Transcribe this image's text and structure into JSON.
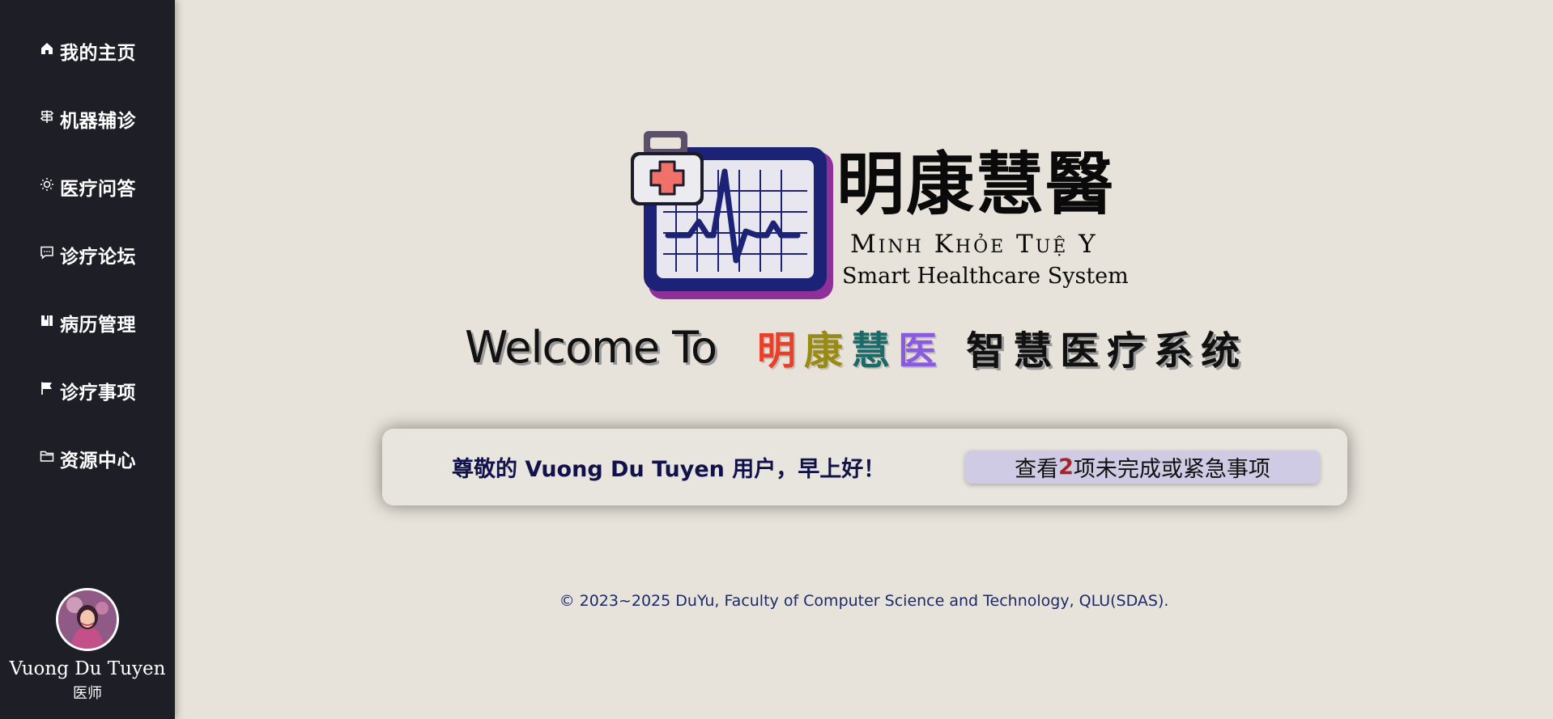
{
  "sidebar": {
    "items": [
      {
        "label": "我的主页",
        "icon": "home-icon"
      },
      {
        "label": "机器辅诊",
        "icon": "signpost-icon"
      },
      {
        "label": "医疗问答",
        "icon": "sun-icon"
      },
      {
        "label": "诊疗论坛",
        "icon": "chat-bubble-icon"
      },
      {
        "label": "病历管理",
        "icon": "records-icon"
      },
      {
        "label": "诊疗事项",
        "icon": "flag-icon"
      },
      {
        "label": "资源中心",
        "icon": "folder-icon"
      }
    ],
    "profile": {
      "name": "Vuong Du Tuyen",
      "role": "医师"
    }
  },
  "logo": {
    "name_zh": "明康慧醫",
    "name_vi": "Minh Khỏe Tuệ Y",
    "name_en": "Smart Healthcare System"
  },
  "welcome": {
    "prefix": "Welcome To",
    "brand_chars": [
      "明",
      "康",
      "慧",
      "医"
    ],
    "brand_colors": [
      "#e8402a",
      "#9a8a12",
      "#1a6a6a",
      "#8a5ae0"
    ],
    "suffix": "智慧医疗系统"
  },
  "greeting": {
    "text": "尊敬的 Vuong Du Tuyen 用户，早上好！",
    "todo_prefix": "查看",
    "todo_count": "2",
    "todo_suffix": "项未完成或紧急事项"
  },
  "footer": {
    "text": "© 2023~2025 DuYu, Faculty of Computer Science and Technology, QLU(SDAS)."
  },
  "colors": {
    "sidebar_bg": "#1d1e26",
    "page_bg": "#e8e3da",
    "accent_count": "#a1262c",
    "button_bg": "#cfcbe4",
    "greeting_text": "#12124a",
    "footer_text": "#1a2a6b"
  }
}
